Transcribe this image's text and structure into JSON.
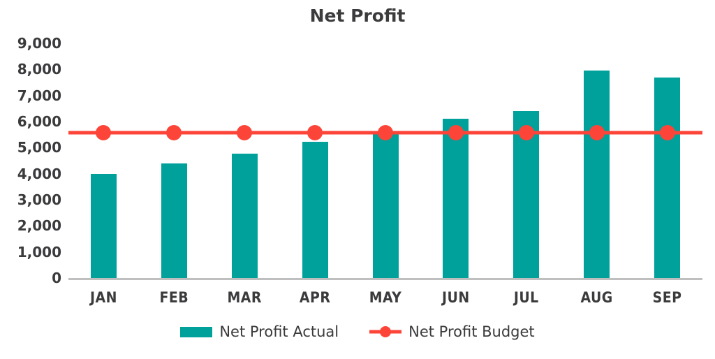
{
  "chart_data": {
    "type": "bar",
    "title": "Net Profit",
    "xlabel": "",
    "ylabel": "",
    "categories": [
      "JAN",
      "FEB",
      "MAR",
      "APR",
      "MAY",
      "JUN",
      "JUL",
      "AUG",
      "SEP"
    ],
    "series": [
      {
        "name": "Net Profit Actual",
        "type": "bar",
        "color": "#00a19b",
        "values": [
          4000,
          4390,
          4780,
          5220,
          5580,
          6100,
          6400,
          7950,
          7680
        ]
      },
      {
        "name": "Net Profit Budget",
        "type": "line",
        "color": "#fd4438",
        "marker": "circle",
        "values": [
          5580,
          5580,
          5580,
          5580,
          5580,
          5580,
          5580,
          5580,
          5580
        ]
      }
    ],
    "ylim": [
      0,
      9000
    ],
    "y_ticks": [
      0,
      1000,
      2000,
      3000,
      4000,
      5000,
      6000,
      7000,
      8000,
      9000
    ],
    "y_tick_labels": [
      "0",
      "1,000",
      "2,000",
      "3,000",
      "4,000",
      "5,000",
      "6,000",
      "7,000",
      "8,000",
      "9,000"
    ],
    "grid": false,
    "legend_position": "bottom-center"
  },
  "legend": {
    "entries": [
      {
        "label": "Net Profit Actual",
        "marker": "bar-swatch-icon"
      },
      {
        "label": "Net Profit Budget",
        "marker": "line-marker-icon"
      }
    ]
  },
  "colors": {
    "bar": "#00a19b",
    "line": "#fd4438",
    "text": "#3b3b3d",
    "axis": "#bfbfbf",
    "background": "#ffffff"
  }
}
